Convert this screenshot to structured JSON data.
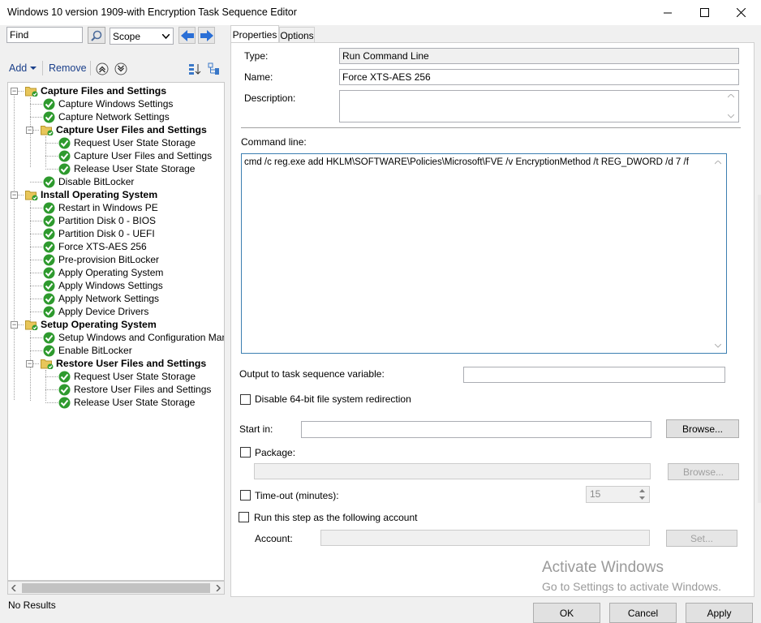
{
  "window": {
    "title": "Windows 10 version 1909-with Encryption Task Sequence Editor"
  },
  "toolbar": {
    "find_value": "Find",
    "scope_value": "Scope",
    "add_label": "Add",
    "remove_label": "Remove"
  },
  "tree": {
    "items": [
      {
        "label": "Capture Files and Settings",
        "type": "group"
      },
      {
        "label": "Capture Windows Settings",
        "type": "step"
      },
      {
        "label": "Capture Network Settings",
        "type": "step"
      },
      {
        "label": "Capture User Files and Settings",
        "type": "group"
      },
      {
        "label": "Request User State Storage",
        "type": "step"
      },
      {
        "label": "Capture User Files and Settings",
        "type": "step"
      },
      {
        "label": "Release User State Storage",
        "type": "step"
      },
      {
        "label": "Disable BitLocker",
        "type": "step"
      },
      {
        "label": "Install Operating System",
        "type": "group"
      },
      {
        "label": "Restart in Windows PE",
        "type": "step"
      },
      {
        "label": "Partition Disk 0 - BIOS",
        "type": "step"
      },
      {
        "label": "Partition Disk 0 - UEFI",
        "type": "step"
      },
      {
        "label": "Force XTS-AES 256",
        "type": "step"
      },
      {
        "label": "Pre-provision BitLocker",
        "type": "step"
      },
      {
        "label": "Apply Operating System",
        "type": "step"
      },
      {
        "label": "Apply Windows Settings",
        "type": "step"
      },
      {
        "label": "Apply Network Settings",
        "type": "step"
      },
      {
        "label": "Apply Device Drivers",
        "type": "step"
      },
      {
        "label": "Setup Operating System",
        "type": "group"
      },
      {
        "label": "Setup Windows and Configuration Manager",
        "type": "step"
      },
      {
        "label": "Enable BitLocker",
        "type": "step"
      },
      {
        "label": "Restore User Files and Settings",
        "type": "group"
      },
      {
        "label": "Request User State Storage",
        "type": "step"
      },
      {
        "label": "Restore User Files and Settings",
        "type": "step"
      },
      {
        "label": "Release User State Storage",
        "type": "step"
      }
    ]
  },
  "status": {
    "text": "No Results"
  },
  "tabs": {
    "properties": "Properties",
    "options": "Options"
  },
  "properties": {
    "type_label": "Type:",
    "type_value": "Run Command Line",
    "name_label": "Name:",
    "name_value": "Force XTS-AES 256",
    "description_label": "Description:",
    "description_value": "",
    "command_line_label": "Command line:",
    "command_line_value": "cmd /c reg.exe add HKLM\\SOFTWARE\\Policies\\Microsoft\\FVE /v EncryptionMethod /t REG_DWORD /d 7 /f",
    "output_variable_label": "Output to task sequence variable:",
    "output_variable_value": "",
    "disable_redirection_label": "Disable 64-bit file system redirection",
    "start_in_label": "Start in:",
    "start_in_value": "",
    "browse_label": "Browse...",
    "package_label": "Package:",
    "package_value": "",
    "package_browse_label": "Browse...",
    "timeout_label": "Time-out (minutes):",
    "timeout_value": "15",
    "run_as_label": "Run this step as the following account",
    "account_label": "Account:",
    "account_value": "",
    "set_label": "Set..."
  },
  "watermark": {
    "line1": "Activate Windows",
    "line2": "Go to Settings to activate Windows."
  },
  "footer": {
    "ok_label": "OK",
    "cancel_label": "Cancel",
    "apply_label": "Apply"
  }
}
